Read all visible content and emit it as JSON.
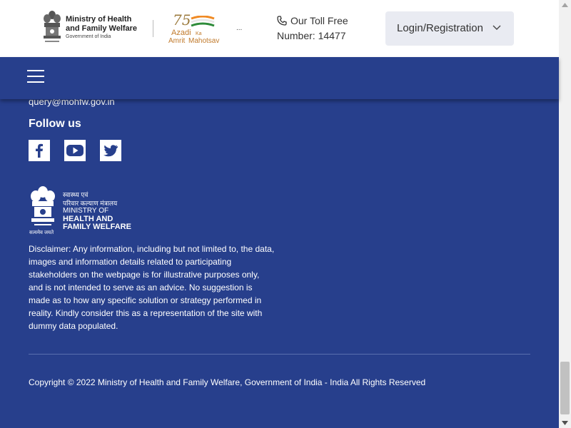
{
  "header": {
    "ministry_title_line1": "Ministry of Health",
    "ministry_title_line2": "and Family Welfare",
    "ministry_subtitle": "Government of India",
    "azadi_line1": "Azadi",
    "azadi_ka": "Ka",
    "azadi_line2": "Amrit",
    "azadi_mahotsav": "Mahotsav",
    "azadi_number": "75",
    "overflow": "...",
    "toll_free_line1": "Our Toll Free",
    "toll_free_line2": "Number: 14477",
    "login_label": "Login/Registration"
  },
  "footer": {
    "email": "query@mohfw.gov.in",
    "follow_heading": "Follow us",
    "social": [
      "facebook-icon",
      "youtube-icon",
      "twitter-icon"
    ],
    "logo": {
      "hindi_line1": "स्वास्थ्य एवं",
      "hindi_line2": "परिवार कल्याण मंत्रालय",
      "english_line1": "MINISTRY OF",
      "english_line2": "HEALTH AND",
      "english_line3": "FAMILY WELFARE",
      "motto": "सत्यमेव जयते"
    },
    "disclaimer": "Disclaimer: Any information, including but not limited to, the data, images and information details related to participating stakeholders on the webpage is for illustrative purposes only, and is not intended to serve as an advice. No suggestion is made as to how any specific solution or strategy performed in reality. Kindly consider this as a representation of the site with dummy data populated.",
    "copyright": "Copyright © 2022 Ministry of Health and Family Welfare, Government of India - India All Rights Reserved"
  },
  "colors": {
    "primary_blue": "#273f8c",
    "header_bg": "#ffffff",
    "login_bg": "#e9ebf2"
  }
}
